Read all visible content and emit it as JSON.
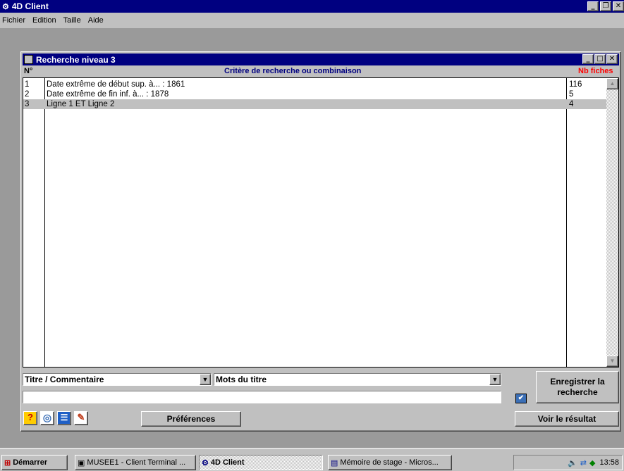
{
  "app": {
    "title": "4D Client"
  },
  "menu": {
    "file": "Fichier",
    "edit": "Edition",
    "size": "Taille",
    "help": "Aide"
  },
  "window": {
    "title": "Recherche niveau 3"
  },
  "table": {
    "headers": {
      "num": "N°",
      "criteria": "Critère de recherche ou combinaison",
      "count": "Nb fiches"
    },
    "rows": [
      {
        "num": "1",
        "criteria": "Date extrême de début sup. à... : 1861",
        "count": "116"
      },
      {
        "num": "2",
        "criteria": "Date extrême de fin inf. à... : 1878",
        "count": "5"
      },
      {
        "num": "3",
        "criteria": "Ligne 1  ET  Ligne 2",
        "count": "4"
      }
    ]
  },
  "form": {
    "field_select": "Titre / Commentaire",
    "operator_select": "Mots du titre",
    "value_input": "",
    "checkbox_mark": "✔"
  },
  "buttons": {
    "save_line1": "Enregistrer la",
    "save_line2": "recherche",
    "preferences": "Préférences",
    "view_result": "Voir le résultat"
  },
  "taskbar": {
    "start": "Démarrer",
    "task1": "MUSEE1 - Client Terminal ...",
    "task2": "4D Client",
    "task3": "Mémoire de stage - Micros...",
    "clock": "13:58"
  },
  "colors": {
    "title_bar": "#000080",
    "count_header": "#ff0000",
    "criteria_header": "#000080",
    "desktop": "#9a9a9a"
  }
}
